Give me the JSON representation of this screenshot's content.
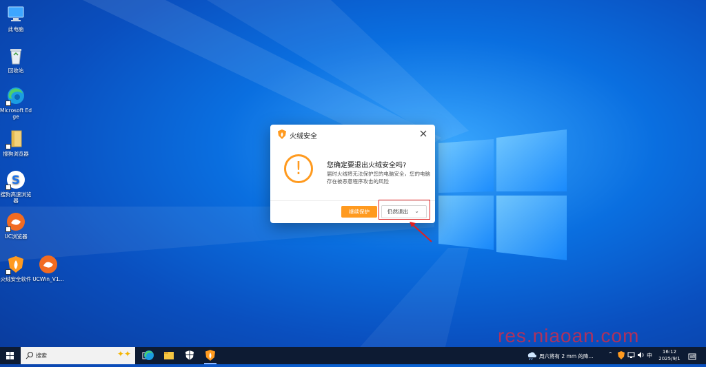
{
  "desktop": {
    "icons": [
      {
        "label": "此电脑"
      },
      {
        "label": "回收站"
      },
      {
        "label": "Microsoft Edge"
      },
      {
        "label": "搜狗浏览器"
      },
      {
        "label": "搜狗高速浏览器"
      },
      {
        "label": "UC浏览器"
      },
      {
        "label": "火绒安全软件"
      },
      {
        "label": "UCWin_V1..."
      }
    ]
  },
  "dialog": {
    "title": "火绒安全",
    "warning_symbol": "!",
    "heading": "您确定要退出火绒安全吗?",
    "description": "届时火绒将无法保护您的电脑安全，您的电脑存在被恶意程序攻击的风险",
    "continue_button": "继续保护",
    "exit_button": "仍然退出",
    "exit_chevron": "⌄"
  },
  "taskbar": {
    "search_placeholder": "搜索",
    "weather_text": "周六将有 2 mm 的降...",
    "ime": "中",
    "time": "16:12",
    "date": "2025/9/1",
    "notification_count": "2"
  },
  "watermark": "res.niaoan.com",
  "colors": {
    "accent_orange": "#ff9a1f",
    "highlight_red": "#e02020",
    "taskbar": "#0d1b33"
  }
}
